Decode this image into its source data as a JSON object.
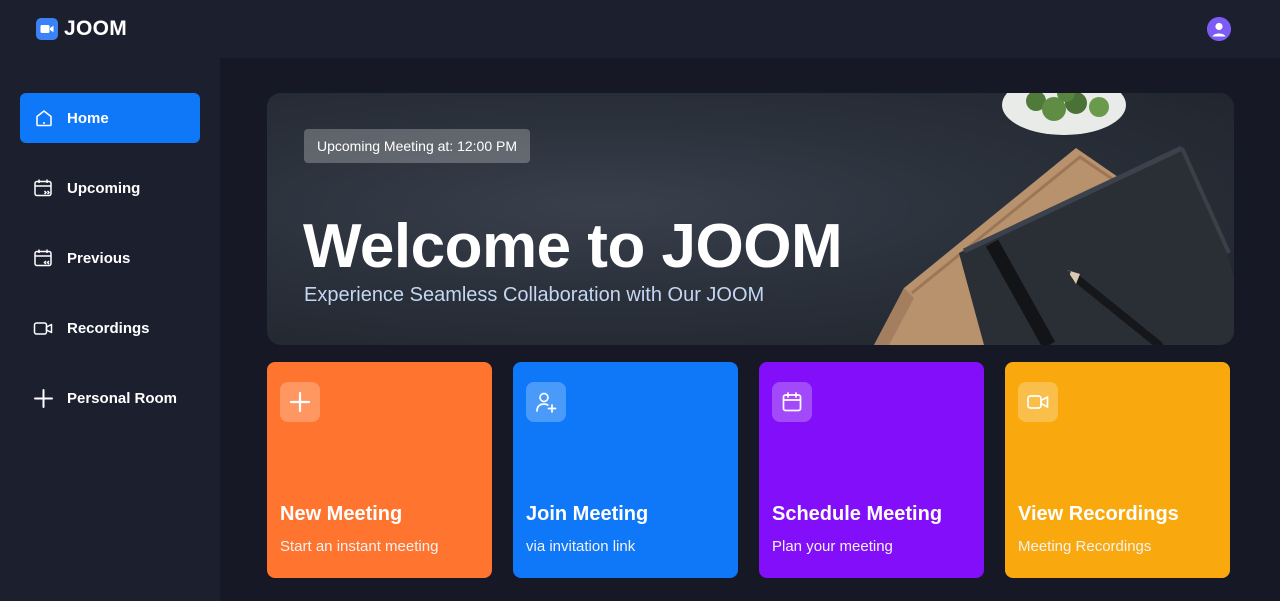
{
  "app": {
    "name": "JOOM"
  },
  "sidebar": {
    "items": [
      {
        "label": "Home",
        "icon": "home-icon",
        "active": true
      },
      {
        "label": "Upcoming",
        "icon": "calendar-forward-icon",
        "active": false
      },
      {
        "label": "Previous",
        "icon": "calendar-back-icon",
        "active": false
      },
      {
        "label": "Recordings",
        "icon": "video-icon",
        "active": false
      },
      {
        "label": "Personal Room",
        "icon": "plus-icon",
        "active": false
      }
    ]
  },
  "hero": {
    "badge": "Upcoming Meeting at: 12:00 PM",
    "title": "Welcome to JOOM",
    "subtitle": "Experience Seamless Collaboration with Our JOOM"
  },
  "cards": [
    {
      "title": "New Meeting",
      "subtitle": "Start an instant meeting",
      "color": "#ff742e",
      "icon": "plus-icon"
    },
    {
      "title": "Join Meeting",
      "subtitle": "via invitation link",
      "color": "#0e78f9",
      "icon": "user-add-icon"
    },
    {
      "title": "Schedule Meeting",
      "subtitle": "Plan your meeting",
      "color": "#830ef9",
      "icon": "calendar-icon"
    },
    {
      "title": "View Recordings",
      "subtitle": "Meeting Recordings",
      "color": "#f9a90e",
      "icon": "video-icon"
    }
  ],
  "colors": {
    "background": "#161925",
    "panel": "#1c1f2e",
    "accent": "#0e78f9"
  }
}
